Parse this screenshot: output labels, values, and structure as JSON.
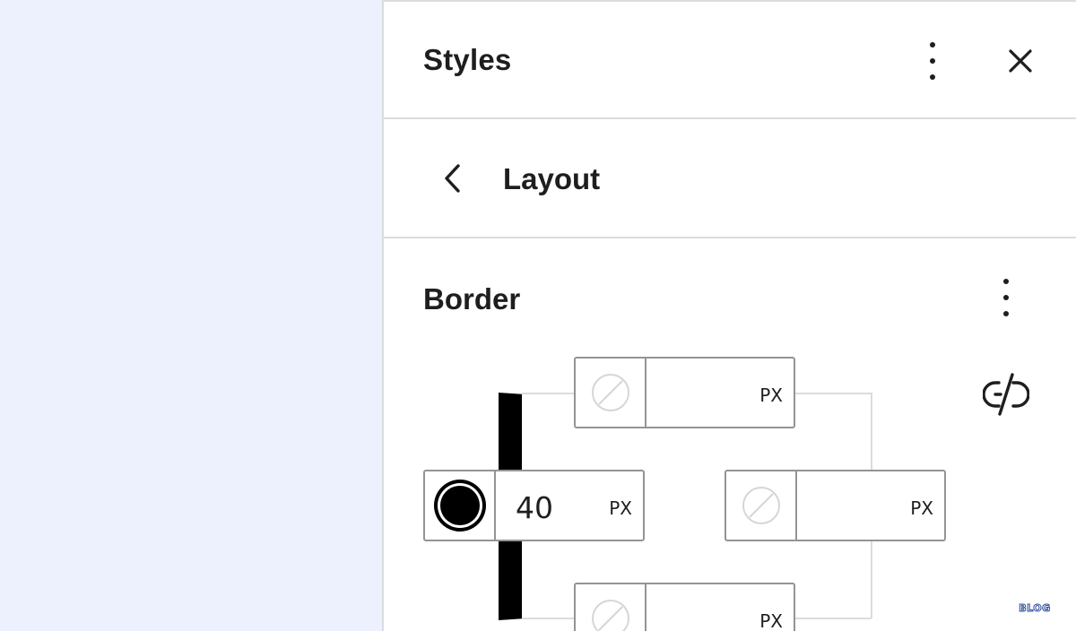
{
  "panel": {
    "title": "Styles",
    "nav_title": "Layout",
    "section_title": "Border"
  },
  "icons": {
    "more_top": "more-vertical-icon",
    "close": "close-icon",
    "back": "chevron-left-icon",
    "more_border": "more-vertical-icon",
    "unlink": "unlink-icon",
    "no_color": "no-color-swatch-icon",
    "color": "color-swatch-icon"
  },
  "border": {
    "unit": "PX",
    "top": {
      "value": ""
    },
    "left": {
      "value": "40",
      "color": "#000000"
    },
    "right": {
      "value": ""
    },
    "bottom": {
      "value": ""
    }
  },
  "colors": {
    "canvas_bg": "#edf1fd",
    "panel_bg": "#ffffff",
    "divider": "#dcdcde",
    "input_border": "#949494",
    "text": "#1e1e1e",
    "border_preview": "#000000"
  },
  "watermark": {
    "text": "BLOG"
  }
}
